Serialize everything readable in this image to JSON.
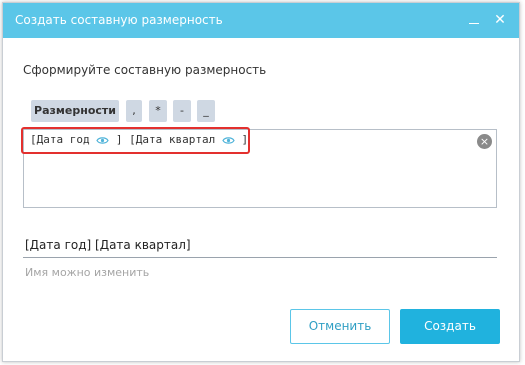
{
  "dialog": {
    "title": "Создать составную размерность",
    "minimize_glyph": "—",
    "close_glyph": "✕"
  },
  "instructions": "Сформируйте составную размерность",
  "toolbar": {
    "dimensions_label": "Размерности",
    "operators": [
      ",",
      "*",
      "-",
      "_"
    ]
  },
  "formula": {
    "tokens": [
      {
        "open": "[Дата год",
        "close": "]"
      },
      {
        "open": "[Дата квартал",
        "close": "]"
      }
    ],
    "clear_glyph": "×"
  },
  "name": {
    "value": "[Дата год] [Дата квартал]",
    "hint": "Имя можно изменить"
  },
  "buttons": {
    "cancel": "Отменить",
    "create": "Создать"
  },
  "colors": {
    "titlebar": "#5bc6e8",
    "primary": "#20b2de",
    "highlight": "#e3302e",
    "chip": "#cfd8e3"
  },
  "icons": {
    "token_visibility": "eye-icon",
    "clear": "clear-icon",
    "close": "close-icon",
    "minimize": "minimize-icon"
  }
}
